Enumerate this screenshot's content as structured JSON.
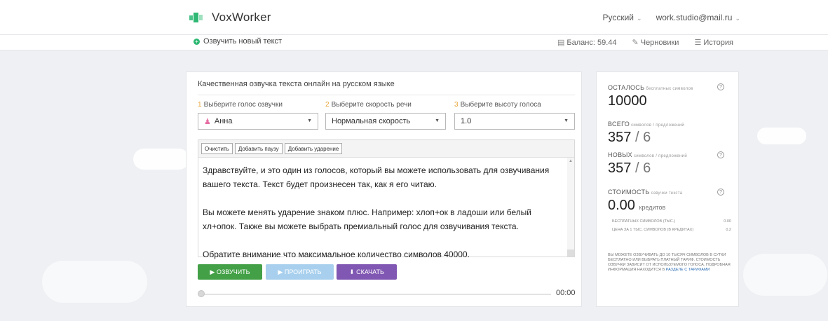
{
  "header": {
    "app_name": "VoxWorker",
    "language": "Русский",
    "user_email": "work.studio@mail.ru"
  },
  "subheader": {
    "new_text": "Озвучить новый текст",
    "balance": "Баланс: 59.44",
    "drafts": "Черновики",
    "history": "История"
  },
  "main": {
    "title": "Качественная озвучка текста онлайн на русском языке",
    "steps": [
      {
        "num": "1",
        "label": "Выберите голос озвучки",
        "value": "Анна"
      },
      {
        "num": "2",
        "label": "Выберите скорость речи",
        "value": "Нормальная скорость"
      },
      {
        "num": "3",
        "label": "Выберите высоту голоса",
        "value": "1.0"
      }
    ],
    "toolbar": {
      "clear": "Очистить",
      "add_pause": "Добавить паузу",
      "add_stress": "Добавить ударение"
    },
    "paragraphs": [
      "Здравствуйте, и это один из голосов, который вы можете использовать для озвучивания вашего текста. Текст будет произнесен так, как я его читаю.",
      "Вы можете менять ударение знаком плюс. Например: хлоп+ок в ладоши или белый хл+опок. Также вы можете выбрать премиальный голос для озвучивания текста.",
      "Обратите внимание что максимальное количество символов 40000."
    ],
    "buttons": {
      "voice": "▶ ОЗВУЧИТЬ",
      "play": "▶ ПРОИГРАТЬ",
      "download": "⬇ СКАЧАТЬ"
    },
    "time": "00:00",
    "progress": 0
  },
  "sidebar": {
    "remaining_label": "ОСТАЛОСЬ",
    "remaining_sub": "бесплатных символов",
    "remaining_value": "10000",
    "total_label": "ВСЕГО",
    "total_sub": "символов / предложений",
    "total_chars": "357",
    "total_sentences": "6",
    "new_label": "НОВЫХ",
    "new_sub": "символов / предложений",
    "new_chars": "357",
    "new_sentences": "6",
    "cost_label": "СТОИМОСТЬ",
    "cost_sub": "озвучки текста",
    "cost_value": "0.00",
    "cost_unit": "кредитов",
    "free_chars_label": "БЕСПЛАТНЫХ СИМВОЛОВ (ТЫС.)",
    "free_chars_value": "0.00",
    "price_label": "ЦЕНА ЗА 1 ТЫС. СИМВОЛОВ (В КРЕДИТАХ)",
    "price_value": "0.2",
    "note": "Вы можете озвучивать до 10 тысяч символов в сутки бесплатно или выбрать платный тариф. Стоимость озвучки зависит от используемого голоса. Подробная информация находится в",
    "note_link": "разделе с тарифами"
  },
  "icons": {
    "logo": "voxworker-logo-icon",
    "help": "question-circle-icon",
    "user": "person-icon"
  },
  "colors": {
    "accent_green": "#43a047",
    "play_blue": "#a8d0ee",
    "download_purple": "#8057b2",
    "step_number": "#e8a435"
  }
}
